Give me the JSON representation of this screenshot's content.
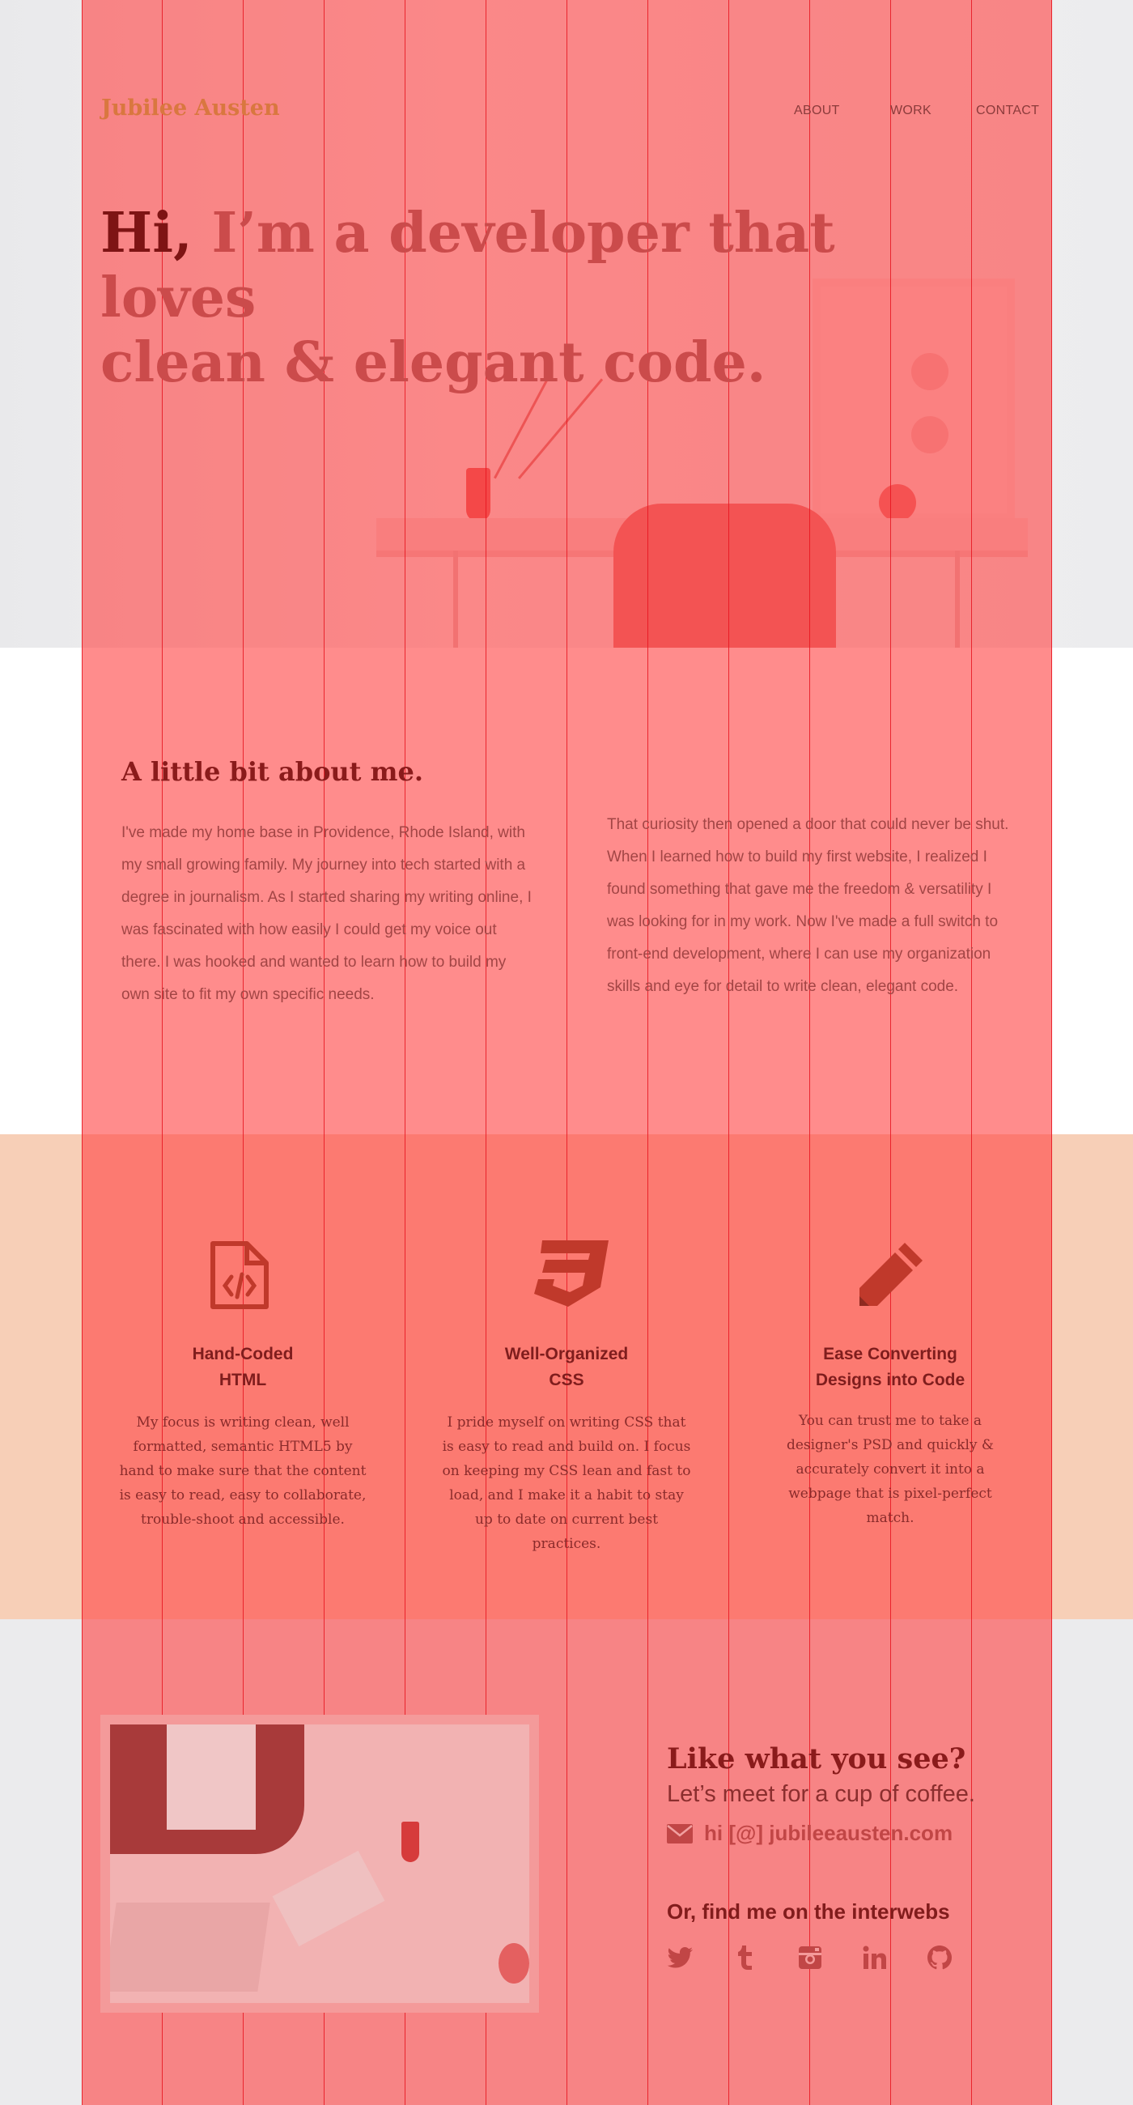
{
  "header": {
    "logo": "Jubilee Austen",
    "nav": [
      {
        "label": "ABOUT"
      },
      {
        "label": "WORK"
      },
      {
        "label": "CONTACT"
      }
    ]
  },
  "hero": {
    "hi": "Hi,",
    "line1_rest": " I’m a developer that loves",
    "line2": "clean & elegant code."
  },
  "about": {
    "heading": "A little bit about me.",
    "left_paragraph": "I've made my home base in Providence, Rhode Island, with my small growing family. My journey into tech started with a degree in journalism. As I started sharing my writing online, I was fascinated with how easily I could get my voice out there. I was hooked and wanted to learn how to build my own site to fit my own specific needs.",
    "right_paragraph": "That curiosity then opened a door that could never be shut. When I learned how to build my first website, I realized I found something that gave me the freedom & versatility I was looking for in my work. Now I've made a full switch to front-end development, where I can use my organization skills and eye for detail to write clean, elegant code."
  },
  "skills": [
    {
      "icon": "file-code-icon",
      "title_line1": "Hand-Coded",
      "title_line2": "HTML",
      "text": "My focus is writing clean, well formatted, semantic HTML5 by hand to make sure that the content is easy to read, easy to collaborate, trouble-shoot and accessible."
    },
    {
      "icon": "css3-icon",
      "title_line1": "Well-Organized",
      "title_line2": "CSS",
      "text": "I pride myself on writing CSS that is easy to read and build on. I focus on keeping my CSS lean and fast to load, and I make it a habit to stay up to date on current best practices."
    },
    {
      "icon": "pencil-icon",
      "title_line1": "Ease Converting",
      "title_line2": "Designs into Code",
      "text": "You can trust me to take a designer's PSD and quickly & accurately convert it into a webpage that is pixel-perfect match."
    }
  ],
  "contact": {
    "heading": "Like what you see?",
    "subheading": "Let’s meet for a cup of coffee.",
    "email": "hi [@] jubileeausten.com",
    "find_heading": "Or, find me on the interwebs",
    "social": [
      {
        "icon": "twitter-icon"
      },
      {
        "icon": "tumblr-icon"
      },
      {
        "icon": "instagram-icon"
      },
      {
        "icon": "linkedin-icon"
      },
      {
        "icon": "github-icon"
      }
    ]
  },
  "colors": {
    "overlay": "#ff4646",
    "peach_band": "#f7cfb7",
    "heading_dark": "#7e1414",
    "logo": "#d9773f"
  }
}
